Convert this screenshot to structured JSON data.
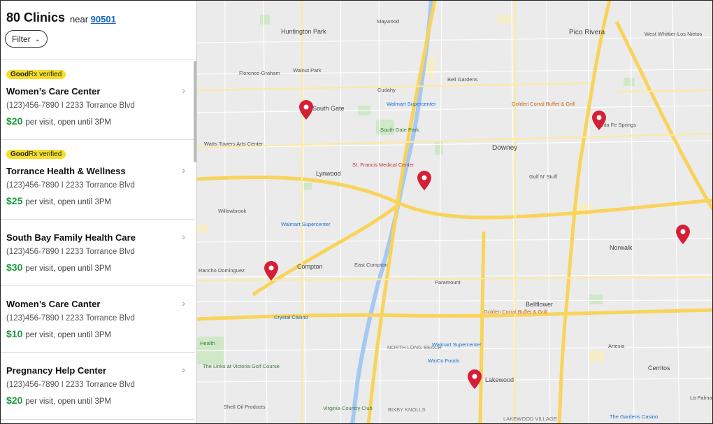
{
  "header": {
    "count_title": "80 Clinics",
    "near_label": "near",
    "zip": "90501",
    "filter_label": "Filter"
  },
  "clinics": [
    {
      "verified": true,
      "name": "Women’s Care Center",
      "phone_address": "(123)456-7890 I 2233 Torrance Blvd",
      "price": "$20",
      "price_note": "per visit, open until 3PM"
    },
    {
      "verified": true,
      "name": "Torrance Health & Wellness",
      "phone_address": "(123)456-7890 I 2233 Torrance Blvd",
      "price": "$25",
      "price_note": "per visit, open until 3PM"
    },
    {
      "verified": false,
      "name": "South Bay Family Health Care",
      "phone_address": "(123)456-7890 I 2233 Torrance Blvd",
      "price": "$30",
      "price_note": "per visit, open until 3PM"
    },
    {
      "verified": false,
      "name": "Women’s Care Canter",
      "phone_address": "(123)456-7890 I 2233 Torrance Blvd",
      "price": "$10",
      "price_note": "per visit, open until 3PM"
    },
    {
      "verified": false,
      "name": "Pregnancy Help Center",
      "phone_address": "(123)456-7890 I 2233 Torrance Blvd",
      "price": "$20",
      "price_note": "per visit, open until 3PM"
    }
  ],
  "badge": {
    "brand_bold": "Good",
    "brand_rest": "Rx verified"
  },
  "map_labels": {
    "huntington_park": "Huntington Park",
    "maywood": "Maywood",
    "pico_rivera": "Pico Rivera",
    "west_whittier": "West Whittier-Los Nietos",
    "walnut_park": "Walnut Park",
    "florence_graham": "Florence-Graham",
    "bell_gardens": "Bell Gardens",
    "cudahy": "Cudahy",
    "south_gate": "South Gate",
    "walmart_1": "Walmart Supercenter",
    "golden_corral_1": "Golden Corral Buffet & Grill",
    "santa_fe_springs": "Santa Fe Springs",
    "south_gate_park": "South Gate Park",
    "downey": "Downey",
    "watts_towers": "Watts Towers Arts Center",
    "st_francis": "St. Francis Medical Center",
    "lynwood": "Lynwood",
    "golf_n_stuff": "Golf N' Stuff",
    "willowbrook": "Willowbrook",
    "walmart_2": "Walmart Supercenter",
    "norwalk": "Norwalk",
    "compton": "Compton",
    "east_compton": "East Compton",
    "paramount": "Paramount",
    "rancho_dominguez": "Rancho Dominguez",
    "bellflower": "Bellflower",
    "golden_corral_2": "Golden Corral Buffet & Grill",
    "crystal_casino": "Crystal Casino",
    "north_long_beach": "NORTH LONG BEACH",
    "walmart_3": "Walmart Supercenter",
    "winco": "WinCo Foods",
    "artesia": "Artesia",
    "cerritos": "Cerritos",
    "lakewood": "Lakewood",
    "links_victoria": "The Links at Victoria Golf Course",
    "health": "Health",
    "shell": "Shell Oil Products",
    "virginia_cc": "Virginia Country Club",
    "bixby_knolls": "BIXBY KNOLLS",
    "lakewood_village": "LAKEWOOD VILLAGE",
    "gardens_casino": "The Gardens Casino",
    "la_palma": "La Palma"
  },
  "colors": {
    "price_green": "#1e9a3e",
    "badge_yellow": "#f5df2a",
    "pin_red": "#d51f36",
    "freeway": "#f9d35a",
    "link_blue": "#1565c0"
  }
}
